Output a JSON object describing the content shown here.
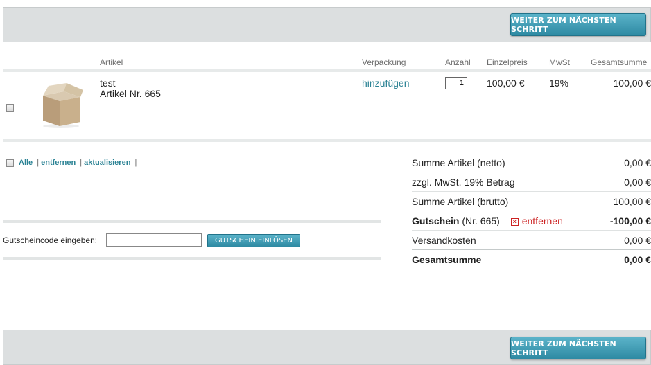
{
  "top_bar": {
    "next_label": "WEITER ZUM NÄCHSTEN SCHRITT"
  },
  "bottom_bar": {
    "next_label": "WEITER ZUM NÄCHSTEN SCHRITT"
  },
  "table": {
    "headers": [
      "Artikel",
      "Verpackung",
      "Anzahl",
      "Einzelpreis",
      "MwSt",
      "Gesamtsumme"
    ],
    "rows": [
      {
        "name": "test",
        "article_no": "Artikel Nr. 665",
        "packaging_link": "hinzufügen",
        "quantity": "1",
        "unit_price": "100,00 €",
        "vat": "19%",
        "total": "100,00 €",
        "image_icon": "box-icon"
      }
    ]
  },
  "actions": {
    "all": "Alle",
    "remove": "entfernen",
    "update": "aktualisieren"
  },
  "coupon": {
    "label": "Gutscheincode eingeben:",
    "value": "",
    "button": "GUTSCHEIN EINLÖSEN"
  },
  "summary": {
    "net_label": "Summe Artikel (netto)",
    "net_value": "0,00 €",
    "vat_label": "zzgl. MwSt. 19% Betrag",
    "vat_value": "0,00 €",
    "gross_label": "Summe Artikel (brutto)",
    "gross_value": "100,00 €",
    "voucher_label": "Gutschein",
    "voucher_nr": "(Nr. 665)",
    "voucher_remove": "entfernen",
    "voucher_value": "-100,00 €",
    "shipping_label": "Versandkosten",
    "shipping_value": "0,00 €",
    "total_label": "Gesamtsumme",
    "total_value": "0,00 €"
  },
  "colors": {
    "accent": "#2a8294",
    "button": "#3a96ae",
    "danger": "#cc2222",
    "bar": "#dcdfe0"
  }
}
